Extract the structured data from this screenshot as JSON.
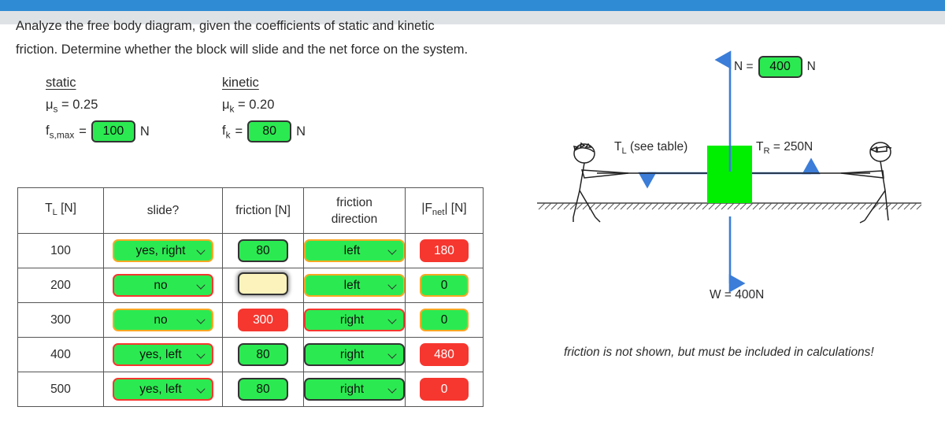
{
  "chrome": {
    "topbar_color": "#2e8bd4",
    "strip_color": "#dfe2e5"
  },
  "prompt": {
    "line1": "Analyze the free body diagram, given the coefficients of static and kinetic",
    "line2": "friction. Determine whether the block will slide and the net force on the",
    "line3": "system."
  },
  "coefficients": {
    "static": {
      "title": "static",
      "mu_label": "μ",
      "mu_sub": "s",
      "mu_value": " = 0.25",
      "f_label": "f",
      "f_sub": "s,max",
      "f_eq": "=",
      "f_value": "100",
      "unit": "N"
    },
    "kinetic": {
      "title": "kinetic",
      "mu_label": "μ",
      "mu_sub": "k",
      "mu_value": " = 0.20",
      "f_label": "f",
      "f_sub": "k",
      "f_eq": "=",
      "f_value": "80",
      "unit": "N"
    }
  },
  "table": {
    "headers": {
      "tl": "T",
      "tl_sub": "L",
      "tl_unit": " [N]",
      "slide": "slide?",
      "friction": "friction [N]",
      "direction_line1": "friction",
      "direction_line2": "direction",
      "fnet_pre": "|F",
      "fnet_sub": "net",
      "fnet_post": "|  [N]"
    },
    "rows": [
      {
        "tl": "100",
        "slide": {
          "value": "yes, right",
          "bg": "green",
          "border": "orange"
        },
        "friction": {
          "value": "80",
          "bg": "green",
          "border": "dark"
        },
        "direction": {
          "value": "left",
          "bg": "green",
          "border": "orange"
        },
        "fnet": {
          "value": "180",
          "bg": "red",
          "border": "none"
        }
      },
      {
        "tl": "200",
        "slide": {
          "value": "no",
          "bg": "green",
          "border": "red"
        },
        "friction": {
          "value": "",
          "bg": "yellow",
          "border": "dark",
          "focused": true
        },
        "direction": {
          "value": "left",
          "bg": "green",
          "border": "orange"
        },
        "fnet": {
          "value": "0",
          "bg": "green",
          "border": "orange"
        }
      },
      {
        "tl": "300",
        "slide": {
          "value": "no",
          "bg": "green",
          "border": "orange"
        },
        "friction": {
          "value": "300",
          "bg": "red",
          "border": "none"
        },
        "direction": {
          "value": "right",
          "bg": "green",
          "border": "red"
        },
        "fnet": {
          "value": "0",
          "bg": "green",
          "border": "orange"
        }
      },
      {
        "tl": "400",
        "slide": {
          "value": "yes, left",
          "bg": "green",
          "border": "red"
        },
        "friction": {
          "value": "80",
          "bg": "green",
          "border": "dark"
        },
        "direction": {
          "value": "right",
          "bg": "green",
          "border": "dark"
        },
        "fnet": {
          "value": "480",
          "bg": "red",
          "border": "none"
        }
      },
      {
        "tl": "500",
        "slide": {
          "value": "yes, left",
          "bg": "green",
          "border": "red"
        },
        "friction": {
          "value": "80",
          "bg": "green",
          "border": "dark"
        },
        "direction": {
          "value": "right",
          "bg": "green",
          "border": "dark"
        },
        "fnet": {
          "value": "0",
          "bg": "red",
          "border": "none"
        }
      }
    ]
  },
  "diagram": {
    "normal": {
      "prefix": "N =",
      "value": "400",
      "unit": "N"
    },
    "tension_left": "T",
    "tension_left_sub": "L",
    "tension_left_rest": " (see table)",
    "tension_right": "T",
    "tension_right_sub": "R",
    "tension_right_rest": " = 250N",
    "weight": "W = 400N",
    "caption": "friction is not shown, but must be included in calculations!",
    "block_color": "#00ee00",
    "arrow_color": "#3b7dd8"
  }
}
